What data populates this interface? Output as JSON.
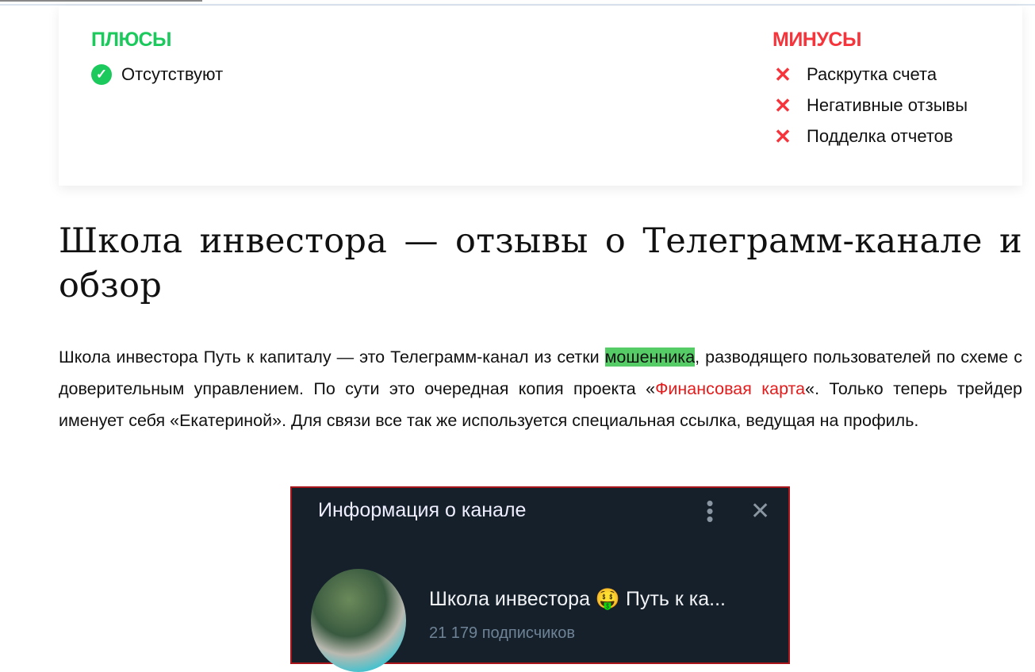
{
  "pros": {
    "title": "ПЛЮСЫ",
    "items": [
      "Отсутствуют"
    ]
  },
  "cons": {
    "title": "МИНУСЫ",
    "items": [
      "Раскрутка счета",
      "Негативные отзывы",
      "Подделка отчетов"
    ]
  },
  "article": {
    "title": "Школа инвестора — отзывы о Телеграмм-канале и обзор",
    "p1_a": "Школа инвестора Путь к капиталу — это Телеграмм-канал из сетки ",
    "p1_highlight": "мошенника",
    "p1_b": ", разводящего пользователей по схеме с доверительным управлением. По сути это очередная копия проекта «",
    "p1_link": "Финансовая карта",
    "p1_c": "«. Только теперь трейдер именует себя «Екатериной». Для связи все так же используется специальная ссылка, ведущая на профиль."
  },
  "telegram": {
    "header": "Информация о канале",
    "dots": "⋮",
    "close": "✕",
    "channel_name": "Школа инвестора 🤑 Путь к ка...",
    "subscribers": "21 179 подписчиков"
  }
}
